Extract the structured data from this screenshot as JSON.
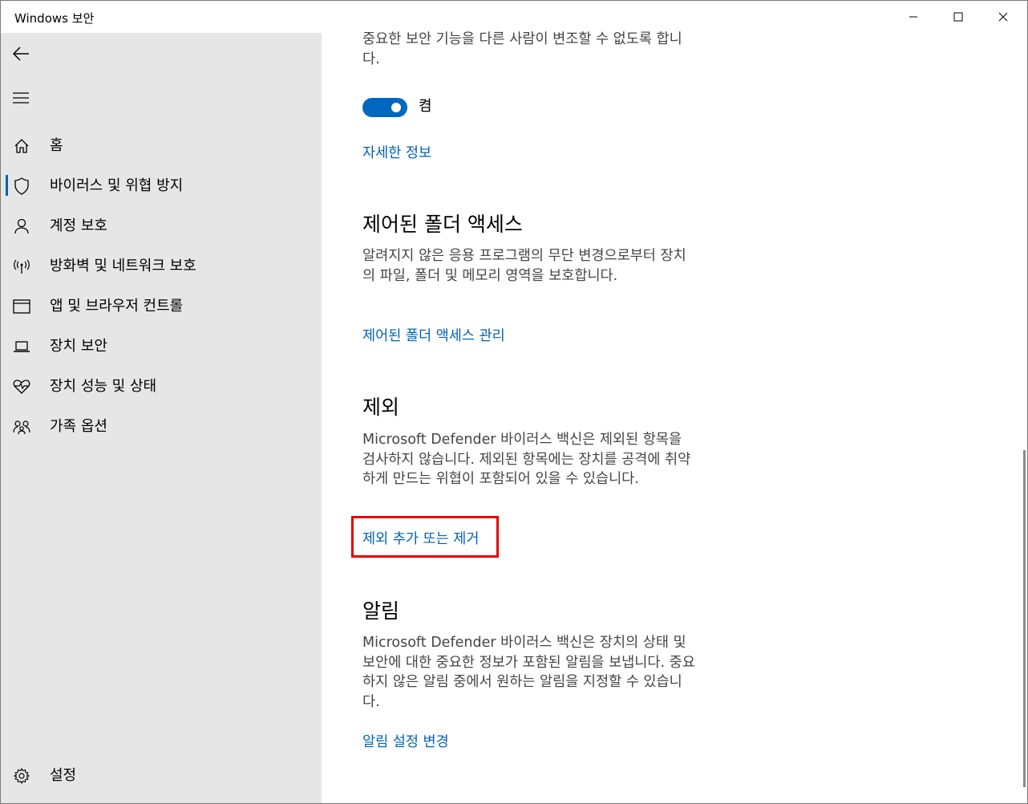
{
  "window": {
    "title": "Windows 보안"
  },
  "sidebar": {
    "back_icon": "back-arrow-icon",
    "menu_icon": "hamburger-icon",
    "items": [
      {
        "label": "홈",
        "icon": "home-icon"
      },
      {
        "label": "바이러스 및 위협 방지",
        "icon": "shield-icon",
        "active": true
      },
      {
        "label": "계정 보호",
        "icon": "person-icon"
      },
      {
        "label": "방화벽 및 네트워크 보호",
        "icon": "antenna-icon"
      },
      {
        "label": "앱 및 브라우저 컨트롤",
        "icon": "browser-window-icon"
      },
      {
        "label": "장치 보안",
        "icon": "laptop-icon"
      },
      {
        "label": "장치 성능 및 상태",
        "icon": "heart-pulse-icon"
      },
      {
        "label": "가족 옵션",
        "icon": "family-icon"
      }
    ],
    "settings_label": "설정"
  },
  "main": {
    "tamper": {
      "description": "중요한 보안 기능을 다른 사람이 변조할 수 없도록 합니다.",
      "toggle_state": "on",
      "toggle_label": "켬",
      "link": "자세한 정보"
    },
    "cfa": {
      "heading": "제어된 폴더 액세스",
      "description": "알려지지 않은 응용 프로그램의 무단 변경으로부터 장치의 파일, 폴더 및 메모리 영역을 보호합니다.",
      "link": "제어된 폴더 액세스 관리"
    },
    "exclusions": {
      "heading": "제외",
      "description": "Microsoft Defender 바이러스 백신은 제외된 항목을 검사하지 않습니다. 제외된 항목에는 장치를 공격에 취약하게 만드는 위협이 포함되어 있을 수 있습니다.",
      "link": "제외 추가 또는 제거"
    },
    "notifications": {
      "heading": "알림",
      "description": "Microsoft Defender 바이러스 백신은 장치의 상태 및 보안에 대한 중요한 정보가 포함된 알림을 보냅니다. 중요하지 않은 알림 중에서 원하는 알림을 지정할 수 있습니다.",
      "link": "알림 설정 변경"
    }
  },
  "colors": {
    "accent": "#0063b1",
    "highlight": "#e60000",
    "sidebar_bg": "#e6e6e6"
  }
}
